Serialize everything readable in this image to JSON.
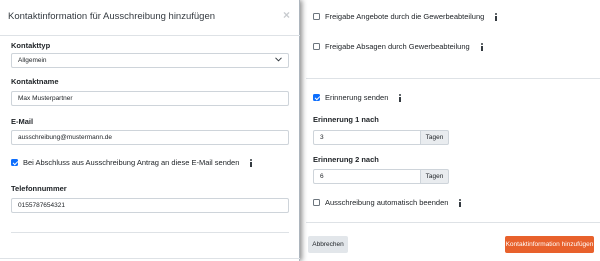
{
  "modal": {
    "title": "Kontaktinformation für Ausschreibung hinzufügen",
    "close_glyph": "×",
    "contact_type": {
      "label": "Kontakttyp",
      "value": "Allgemein"
    },
    "contact_name": {
      "label": "Kontaktname",
      "value": "Max Musterpartner"
    },
    "email": {
      "label": "E-Mail",
      "value": "ausschreibung@mustermann.de"
    },
    "email_notice_checkbox": {
      "label": "Bei Abschluss aus Ausschreibung Antrag an diese E-Mail senden",
      "checked": true
    },
    "phone": {
      "label": "Telefonnummer",
      "value": "0155787654321"
    }
  },
  "background_form": {
    "approve_offers": {
      "label": "Freigabe Angebote durch die Gewerbeabteilung",
      "checked": false
    },
    "approve_rejections": {
      "label": "Freigabe Absagen durch Gewerbeabteilung",
      "checked": false
    },
    "send_reminder": {
      "label": "Erinnerung senden",
      "checked": true
    },
    "reminder1": {
      "label": "Erinnerung 1 nach",
      "value": "3",
      "unit": "Tagen"
    },
    "reminder2": {
      "label": "Erinnerung 2 nach",
      "value": "6",
      "unit": "Tagen"
    },
    "auto_end": {
      "label": "Ausschreibung automatisch beenden",
      "checked": false
    },
    "cancel_label": "Abbrechen",
    "submit_label": "Kontaktinformation hinzufügen"
  },
  "colors": {
    "accent": "#e8612c",
    "checkbox": "#0d6efd"
  },
  "icons": [
    "info-icon",
    "close-icon",
    "chevron-down-icon"
  ]
}
